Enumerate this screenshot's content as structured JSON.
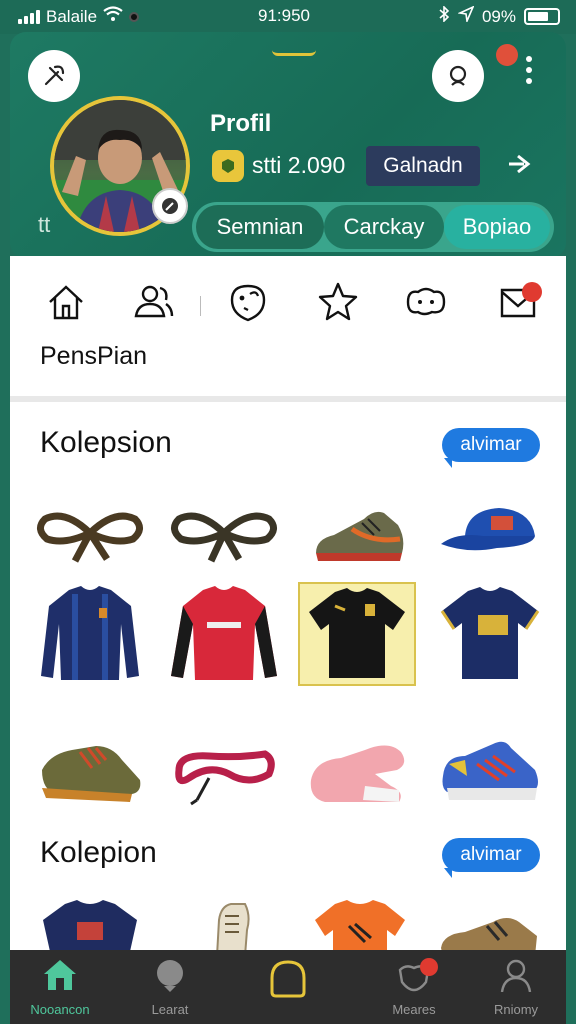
{
  "status_bar": {
    "carrier": "Balaile",
    "time": "91:950",
    "battery": "09%"
  },
  "header": {
    "profile_title": "Profil",
    "points": "stti 2.090",
    "gain_button": "Galnadn",
    "left_mark": "tt",
    "tabs": [
      {
        "label": "Semnian"
      },
      {
        "label": "Carckay"
      },
      {
        "label": "Bopiao"
      }
    ]
  },
  "quick_actions": {
    "label": "PensPian",
    "icons": [
      "home-icon",
      "users-icon",
      "face-icon",
      "star-icon",
      "chat-icon",
      "mail-icon"
    ]
  },
  "sections": [
    {
      "title": "Kolepsion",
      "tag": "alvimar",
      "items": [
        "brown-laces",
        "dark-laces",
        "orange-sneaker",
        "blue-cap",
        "navy-jersey",
        "red-jersey",
        "black-shirt",
        "navy-shirt",
        "muddy-boot",
        "magenta-laces",
        "pink-shoe",
        "blue-sneaker"
      ]
    },
    {
      "title": "Kolepion",
      "tag": "alvimar",
      "items": [
        "maroon-shirt",
        "white-boot",
        "orange-shirt",
        "gold-boot"
      ]
    }
  ],
  "bottom_nav": [
    {
      "label": "Nooancon",
      "icon": "home-icon",
      "active": true
    },
    {
      "label": "Learat",
      "icon": "ball-icon",
      "active": false
    },
    {
      "label": "",
      "icon": "add-icon",
      "active": false
    },
    {
      "label": "Meares",
      "icon": "bell-icon",
      "active": false
    },
    {
      "label": "Rniomy",
      "icon": "user-icon",
      "active": false
    }
  ],
  "colors": {
    "primary": "#1e7a63",
    "accent_gold": "#e6c53a",
    "tag_blue": "#1f7ae0",
    "nav_active": "#4fc79c"
  }
}
